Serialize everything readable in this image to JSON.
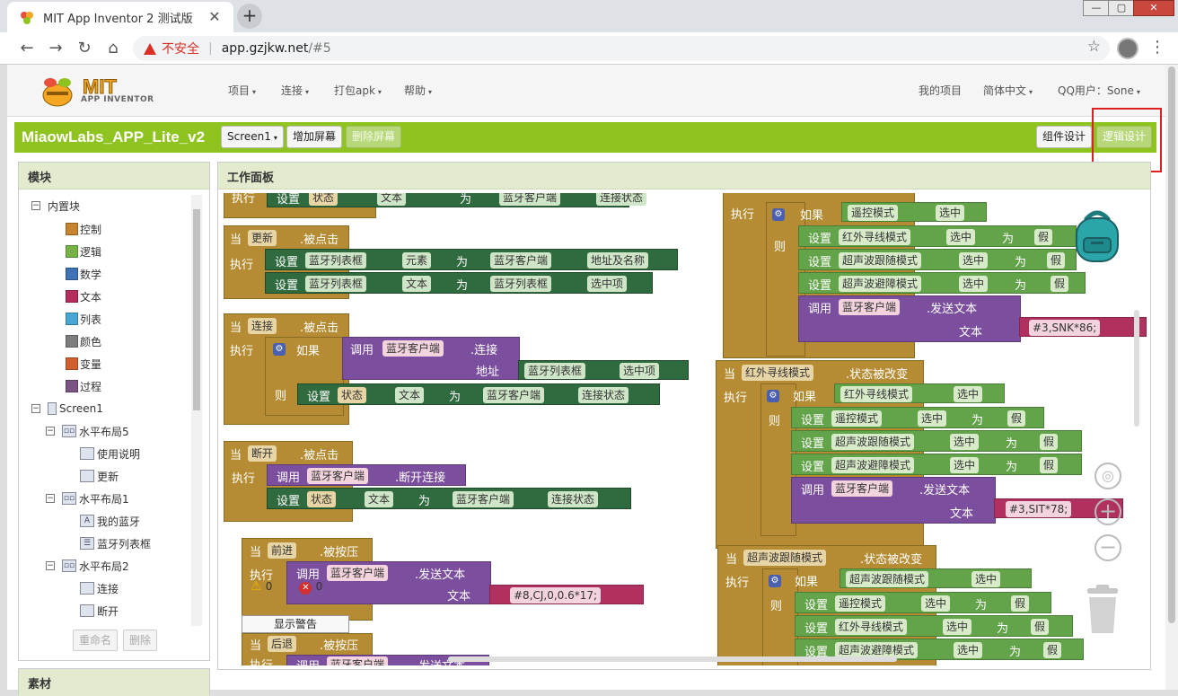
{
  "browser": {
    "tab_title": "MIT App Inventor 2 测试版",
    "tab_close": "✕",
    "new_tab": "+",
    "insecure_label": "不安全",
    "url_separator": "|",
    "url_host": "app.gzjkw.net",
    "url_path": "/#5",
    "window_controls": [
      "—",
      "▢",
      "✕"
    ]
  },
  "logo": {
    "mit": "MIT",
    "sub": "APP INVENTOR"
  },
  "topnav": {
    "left_menus": [
      "项目",
      "连接",
      "打包apk",
      "帮助"
    ],
    "my_projects": "我的项目",
    "language": "简体中文",
    "user": "QQ用户：Sone"
  },
  "toolbar": {
    "project_name": "MiaowLabs_APP_Lite_v2",
    "screen_select": "Screen1",
    "add_screen": "增加屏幕",
    "remove_screen": "删除屏幕",
    "designer": "组件设计",
    "blocks": "逻辑设计"
  },
  "blocks_panel": {
    "title": "模块",
    "builtin": "内置块",
    "builtin_items": [
      {
        "label": "控制",
        "color": "#c88330"
      },
      {
        "label": "逻辑",
        "color": "#77b246"
      },
      {
        "label": "数学",
        "color": "#3f71b5"
      },
      {
        "label": "文本",
        "color": "#b32d5e"
      },
      {
        "label": "列表",
        "color": "#49a6d4"
      },
      {
        "label": "颜色",
        "color": "#7d7d7d"
      },
      {
        "label": "变量",
        "color": "#d05f2d"
      },
      {
        "label": "过程",
        "color": "#7c5385"
      }
    ],
    "screen1": "Screen1",
    "components": [
      {
        "label": "水平布局5",
        "level": 1
      },
      {
        "label": "使用说明",
        "level": 2
      },
      {
        "label": "更新",
        "level": 2
      },
      {
        "label": "水平布局1",
        "level": 1
      },
      {
        "label": "我的蓝牙",
        "level": 2
      },
      {
        "label": "蓝牙列表框",
        "level": 2
      },
      {
        "label": "水平布局2",
        "level": 1
      },
      {
        "label": "连接",
        "level": 2
      },
      {
        "label": "断开",
        "level": 2
      }
    ],
    "rename": "重命名",
    "delete": "删除"
  },
  "materials_panel": {
    "title": "素材"
  },
  "workspace": {
    "title": "工作面板",
    "warnings_count": "0",
    "errors_count": "0",
    "show_warnings": "显示警告",
    "zoom_in": "+",
    "zoom_out": "−"
  },
  "blocks": {
    "when": "当",
    "do": "执行",
    "set": "设置",
    "to": "为",
    "call": "调用",
    "if": "如果",
    "then": "则",
    "text": "文本",
    "address": "地址",
    "false": "假",
    "dot": ".",
    "top_partial": {
      "chips": [
        "状态",
        "文本",
        "蓝牙客户端",
        "连接状态"
      ]
    },
    "update_click": {
      "comp": "更新",
      "event": ".被点击",
      "rows": [
        [
          "蓝牙列表框",
          "元素",
          "蓝牙客户端",
          "地址及名称"
        ],
        [
          "蓝牙列表框",
          "文本",
          "蓝牙列表框",
          "选中项"
        ]
      ]
    },
    "connect_click": {
      "comp": "连接",
      "event": ".被点击",
      "call_comp": "蓝牙客户端",
      "call_method": ".连接",
      "addr_comp": "蓝牙列表框",
      "addr_prop": "选中项",
      "set_row": [
        "状态",
        "文本",
        "蓝牙客户端",
        "连接状态"
      ]
    },
    "disconnect_click": {
      "comp": "断开",
      "event": ".被点击",
      "call_comp": "蓝牙客户端",
      "call_method": ".断开连接",
      "set_row": [
        "状态",
        "文本",
        "蓝牙客户端",
        "连接状态"
      ]
    },
    "forward_press": {
      "comp": "前进",
      "event": ".被按压",
      "call_comp": "蓝牙客户端",
      "call_method": ".发送文本",
      "value": "#8,CJ,0,0.6*17;"
    },
    "back_press": {
      "comp": "后退",
      "event": ".被按压",
      "call_comp": "蓝牙客户端",
      "call_method": ".发送文本"
    },
    "remote_partial": {
      "cond": [
        "遥控模式",
        "选中"
      ],
      "rows": [
        [
          "红外寻线模式",
          "选中"
        ],
        [
          "超声波跟随模式",
          "选中"
        ],
        [
          "超声波避障模式",
          "选中"
        ]
      ],
      "call_comp": "蓝牙客户端",
      "call_method": ".发送文本",
      "value": "#3,SNK*86;"
    },
    "ir_change": {
      "comp": "红外寻线模式",
      "event": ".状态被改变",
      "cond": [
        "红外寻线模式",
        "选中"
      ],
      "rows": [
        [
          "遥控模式",
          "选中"
        ],
        [
          "超声波跟随模式",
          "选中"
        ],
        [
          "超声波避障模式",
          "选中"
        ]
      ],
      "call_comp": "蓝牙客户端",
      "call_method": ".发送文本",
      "value": "#3,SIT*78;"
    },
    "us_follow_change": {
      "comp": "超声波跟随模式",
      "event": ".状态被改变",
      "cond": [
        "超声波跟随模式",
        "选中"
      ],
      "rows": [
        [
          "遥控模式",
          "选中"
        ],
        [
          "红外寻线模式",
          "选中"
        ],
        [
          "超声波避障模式",
          "选中"
        ]
      ]
    }
  }
}
